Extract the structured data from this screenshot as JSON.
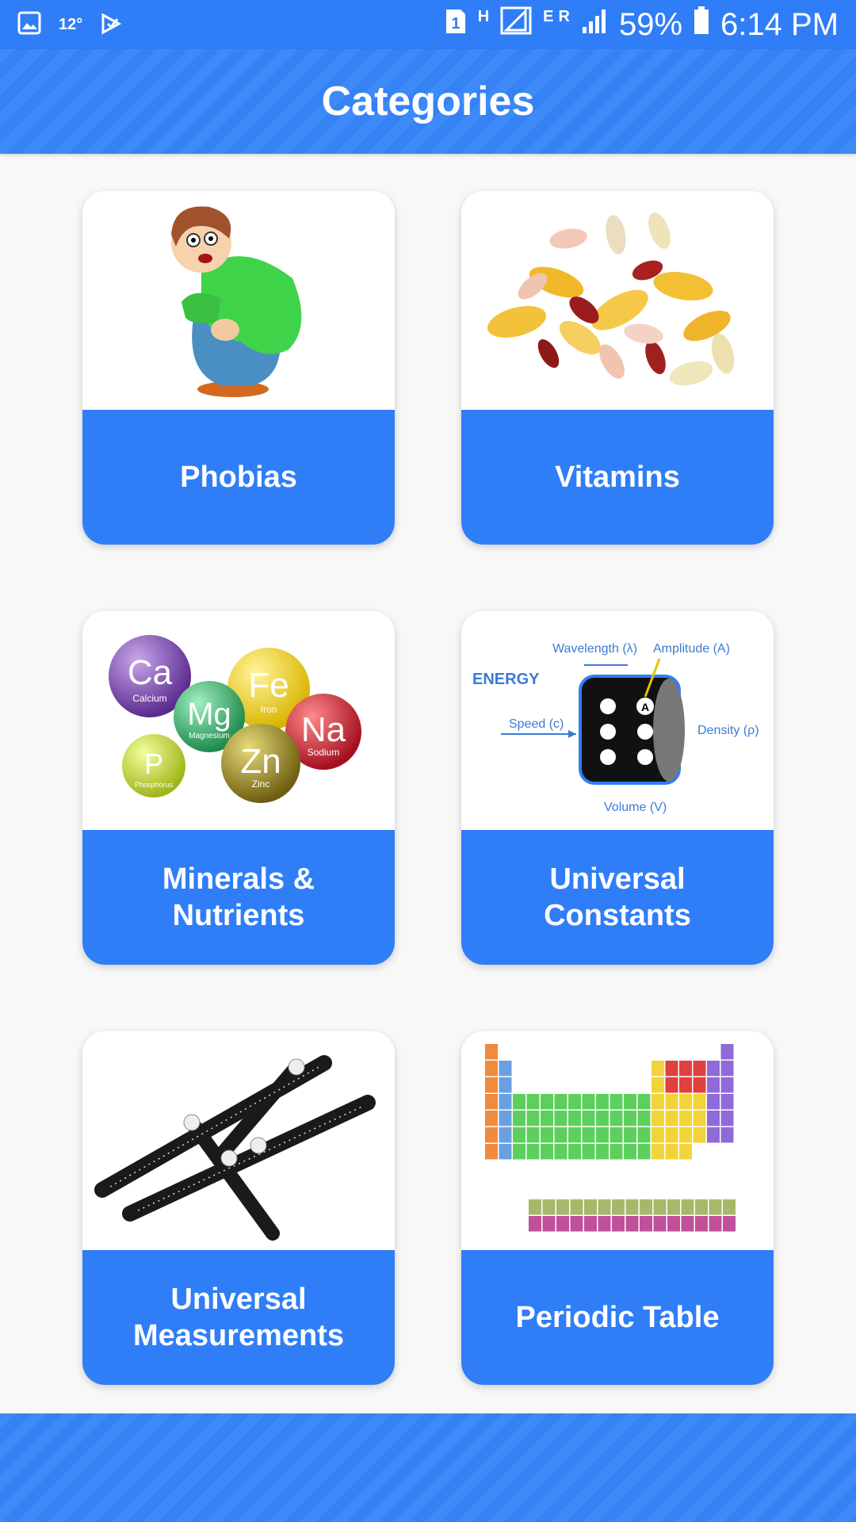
{
  "status_bar": {
    "temperature": "12°",
    "sim_badge": "1",
    "network_h": "H",
    "network_e": "E",
    "network_r": "R",
    "battery": "59%",
    "time": "6:14 PM",
    "icons": [
      "gallery-icon",
      "play-store-icon",
      "sim-icon",
      "signal-icon",
      "battery-icon"
    ]
  },
  "app_bar": {
    "title": "Categories"
  },
  "categories": [
    {
      "label": "Phobias",
      "image": "scared-boy"
    },
    {
      "label": "Vitamins",
      "image": "pills"
    },
    {
      "label": "Minerals & Nutrients",
      "image": "mineral-spheres"
    },
    {
      "label": "Universal Constants",
      "image": "energy-diagram"
    },
    {
      "label": "Universal Measurements",
      "image": "angle-ruler"
    },
    {
      "label": "Periodic Table",
      "image": "periodic-table"
    }
  ],
  "images": {
    "minerals": [
      "Ca",
      "Fe",
      "Mg",
      "Na",
      "P",
      "Zn"
    ],
    "mineral_names": [
      "Calcium",
      "Iron",
      "Magnesium",
      "Sodium",
      "Phosphorus",
      "Zinc"
    ],
    "energy": {
      "title": "ENERGY",
      "wavelength": "Wavelength (λ)",
      "amplitude": "Amplitude (A)",
      "speed": "Speed (c)",
      "density": "Density (ρ)",
      "volume": "Volume (V)",
      "amp_marker": "A"
    }
  },
  "colors": {
    "primary": "#2f7ef7",
    "background": "#f8f8f8",
    "text_on_primary": "#ffffff"
  }
}
